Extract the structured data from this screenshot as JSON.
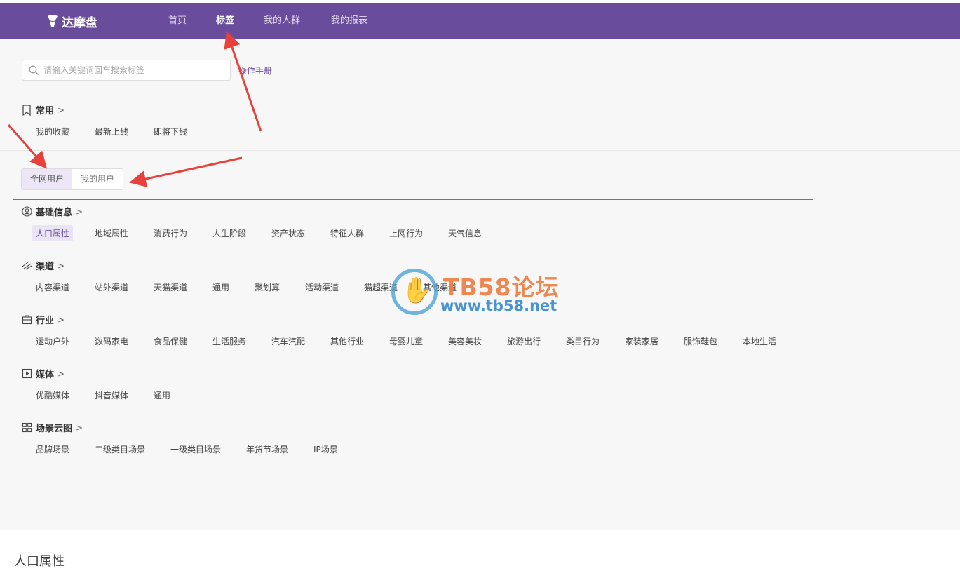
{
  "header": {
    "brand": "达摩盘",
    "nav": [
      {
        "label": "首页"
      },
      {
        "label": "标签"
      },
      {
        "label": "我的人群"
      },
      {
        "label": "我的报表"
      }
    ],
    "active_nav": "标签"
  },
  "search": {
    "placeholder": "请输入关键词回车搜索标签",
    "manual_link": "操作手册"
  },
  "common": {
    "title": "常用",
    "chevron": ">",
    "items": [
      "我的收藏",
      "最新上线",
      "即将下线"
    ]
  },
  "audience_toggle": {
    "options": [
      "全网用户",
      "我的用户"
    ],
    "selected": "全网用户"
  },
  "categories": [
    {
      "title": "基础信息",
      "icon": "user-circle-icon",
      "items": [
        "人口属性",
        "地域属性",
        "消费行为",
        "人生阶段",
        "资产状态",
        "特征人群",
        "上网行为",
        "天气信息"
      ],
      "active_item": "人口属性"
    },
    {
      "title": "渠道",
      "icon": "channel-icon",
      "items": [
        "内容渠道",
        "站外渠道",
        "天猫渠道",
        "通用",
        "聚划算",
        "活动渠道",
        "猫超渠道",
        "其他渠道"
      ]
    },
    {
      "title": "行业",
      "icon": "briefcase-icon",
      "items": [
        "运动户外",
        "数码家电",
        "食品保健",
        "生活服务",
        "汽车汽配",
        "其他行业",
        "母婴儿童",
        "美容美妆",
        "旅游出行",
        "类目行为",
        "家装家居",
        "服饰鞋包",
        "本地生活"
      ]
    },
    {
      "title": "媒体",
      "icon": "play-icon",
      "items": [
        "优酷媒体",
        "抖音媒体",
        "通用"
      ]
    },
    {
      "title": "场景云图",
      "icon": "grid-icon",
      "items": [
        "品牌场景",
        "二级类目场景",
        "一级类目场景",
        "年货节场景",
        "IP场景"
      ]
    }
  ],
  "watermark": {
    "title": "TB58论坛",
    "url": "www.tb58.net"
  },
  "bottom": {
    "title": "人口属性"
  },
  "colors": {
    "brand": "#6a4c9c",
    "annotation_red": "#e04848"
  }
}
